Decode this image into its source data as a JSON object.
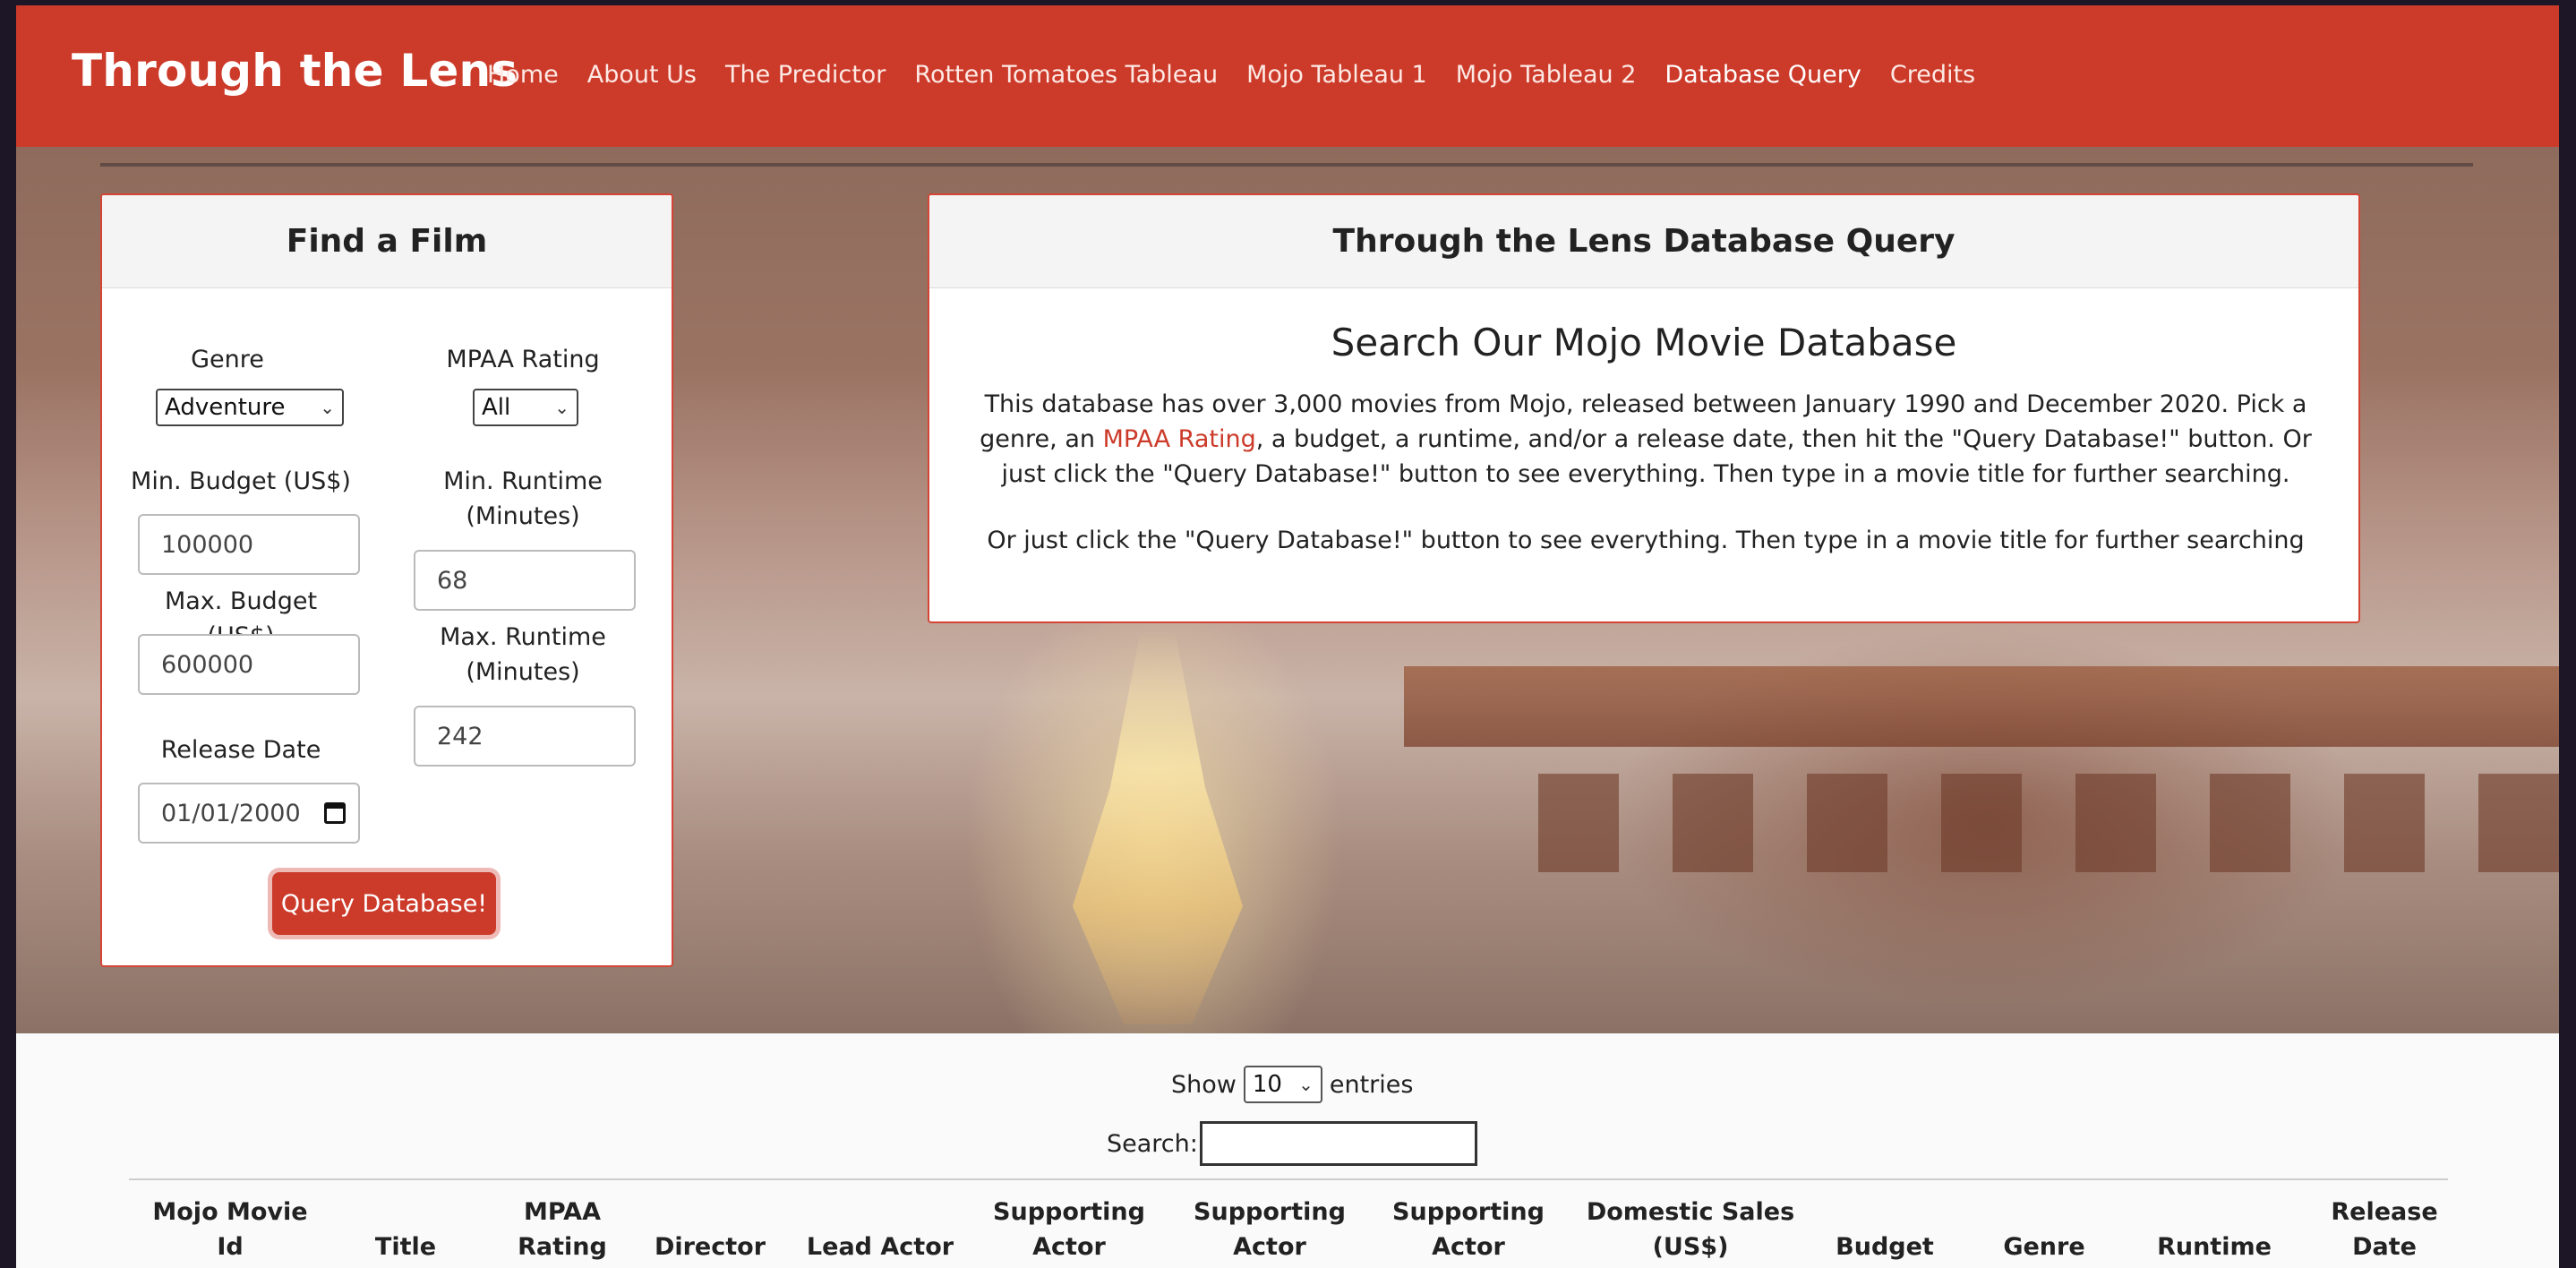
{
  "navbar": {
    "brand": "Through the Lens",
    "links": [
      "Home",
      "About Us",
      "The Predictor",
      "Rotten Tomatoes Tableau",
      "Mojo Tableau 1",
      "Mojo Tableau 2",
      "Database Query",
      "Credits"
    ],
    "active": "Database Query"
  },
  "find_film": {
    "title": "Find a Film",
    "genre_label": "Genre",
    "genre_value": "Adventure",
    "mpaa_label": "MPAA Rating",
    "mpaa_value": "All",
    "min_budget_label": "Min. Budget (US$)",
    "min_budget_value": "100000",
    "max_budget_label": "Max. Budget (US$)",
    "max_budget_value": "600000",
    "min_runtime_label_1": "Min. Runtime",
    "min_runtime_label_2": "(Minutes)",
    "min_runtime_value": "68",
    "max_runtime_label_1": "Max. Runtime",
    "max_runtime_label_2": "(Minutes)",
    "max_runtime_value": "242",
    "release_date_label": "Release Date",
    "release_date_value": "01/01/2000",
    "query_button": "Query Database!"
  },
  "db_panel": {
    "title": "Through the Lens Database Query",
    "subtitle": "Search Our Mojo Movie Database",
    "desc_part1": "This database has over 3,000 movies from Mojo, released between January 1990 and December 2020. Pick a genre, an ",
    "desc_link": "MPAA Rating",
    "desc_part2": ", a budget, a runtime, and/or a release date, then hit the \"Query Database!\" button. Or just click the \"Query Database!\" button to see everything. Then type in a movie title for further searching.",
    "desc2": "Or just click the \"Query Database!\" button to see everything. Then type in a movie title for further searching"
  },
  "table": {
    "show_label": "Show",
    "entries_value": "10",
    "entries_label": "entries",
    "search_label": "Search:",
    "columns": [
      [
        "Mojo Movie",
        "Id"
      ],
      [
        "",
        "Title"
      ],
      [
        "MPAA",
        "Rating"
      ],
      [
        "",
        "Director"
      ],
      [
        "",
        "Lead Actor"
      ],
      [
        "Supporting",
        "Actor"
      ],
      [
        "Supporting",
        "Actor"
      ],
      [
        "Supporting",
        "Actor"
      ],
      [
        "Domestic Sales",
        "(US$)"
      ],
      [
        "",
        "Budget"
      ],
      [
        "",
        "Genre"
      ],
      [
        "",
        "Runtime"
      ],
      [
        "Release",
        "Date"
      ]
    ]
  }
}
